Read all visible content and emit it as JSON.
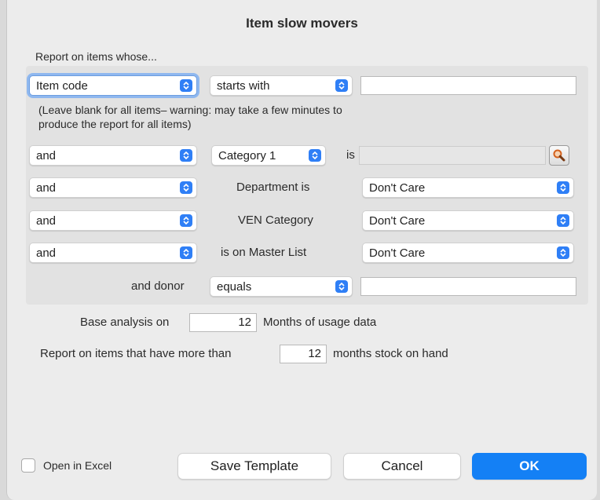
{
  "dialog": {
    "title": "Item slow movers"
  },
  "intro_label": "Report on items whose...",
  "row1": {
    "field_select": "Item code",
    "operator_select": "starts with",
    "value_input": ""
  },
  "hint_line1": "(Leave blank for all items– warning: may take a few minutes to",
  "hint_line2": "produce the report for all items)",
  "row2": {
    "conj": "and",
    "category_select": "Category 1",
    "is_label": "is",
    "value": ""
  },
  "row3": {
    "conj": "and",
    "label": "Department is",
    "value": "Don't Care"
  },
  "row4": {
    "conj": "and",
    "label": "VEN Category",
    "value": "Don't Care"
  },
  "row5": {
    "conj": "and",
    "label": "is on Master List",
    "value": "Don't Care"
  },
  "row6": {
    "label": "and donor",
    "operator": "equals",
    "value": ""
  },
  "analysis": {
    "prefix": "Base analysis on",
    "months": "12",
    "suffix": "Months of usage data"
  },
  "stock": {
    "prefix": "Report on items that have more than",
    "months": "12",
    "suffix": "months stock on hand"
  },
  "footer": {
    "open_in_excel": "Open in Excel",
    "open_in_excel_checked": false,
    "save_template": "Save Template",
    "cancel": "Cancel",
    "ok": "OK"
  },
  "colors": {
    "accent": "#1480f5",
    "focus_ring": "#8fb8ef"
  }
}
